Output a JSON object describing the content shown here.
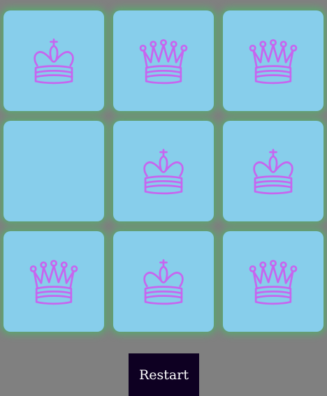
{
  "board": {
    "cells": [
      {
        "piece": "king"
      },
      {
        "piece": "queen"
      },
      {
        "piece": "queen"
      },
      {
        "piece": "empty"
      },
      {
        "piece": "king"
      },
      {
        "piece": "king"
      },
      {
        "piece": "queen"
      },
      {
        "piece": "king"
      },
      {
        "piece": "queen"
      }
    ]
  },
  "controls": {
    "restart_label": "Restart"
  },
  "colors": {
    "background": "#808080",
    "tile": "#87ceeb",
    "tile_glow": "#5ba86f",
    "piece": "#c765ef",
    "button_bg": "#0e0022",
    "button_text": "#ffffff"
  }
}
